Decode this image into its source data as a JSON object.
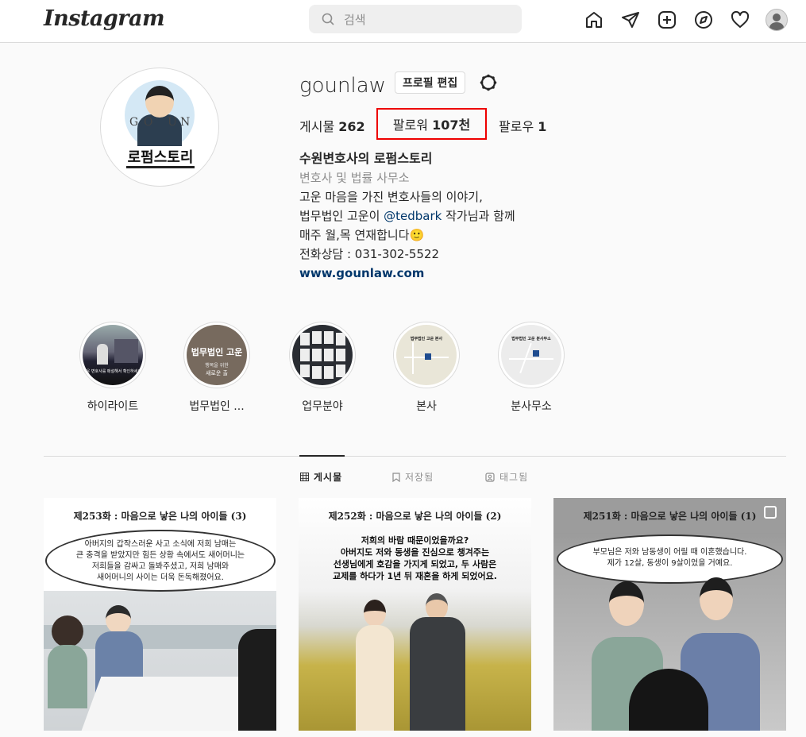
{
  "nav": {
    "logo": "Instagram",
    "search_placeholder": "검색"
  },
  "profile": {
    "username": "gounlaw",
    "edit_button": "프로필 편집",
    "pic_letters": [
      "G",
      "O",
      "U",
      "N"
    ],
    "pic_title": "로펌스토리",
    "stats": {
      "posts_label": "게시물",
      "posts_count": "262",
      "followers_label": "팔로워",
      "followers_count": "107천",
      "following_label": "팔로우",
      "following_count": "1"
    },
    "bio": {
      "name": "수원변호사의 로펌스토리",
      "category": "변호사 및 법률 사무소",
      "line1": "고운 마음을 가진 변호사들의 이야기,",
      "line2_pre": "법무법인 고운이 ",
      "line2_mention": "@tedbark",
      "line2_post": " 작가님과 함께",
      "line3": "매주 월,목 연재합니다🙂",
      "line4": "전화상담 : 031-302-5522",
      "link": "www.gounlaw.com"
    }
  },
  "highlights": [
    {
      "label": "하이라이트",
      "caption": "고운 변호사를 매설해서 확인하세요!"
    },
    {
      "label": "법무법인 ...",
      "caption_top": "법무법인 고운",
      "caption_mid": "행복을 위한",
      "caption_bot": "새로운 출"
    },
    {
      "label": "업무분야"
    },
    {
      "label": "본사",
      "caption": "법무법인 고운 본사"
    },
    {
      "label": "분사무소",
      "caption": "법무법인 고운 분사무소"
    }
  ],
  "tabs": [
    {
      "label": "게시물",
      "icon": "grid-icon",
      "active": true
    },
    {
      "label": "저장됨",
      "icon": "bookmark-icon",
      "active": false
    },
    {
      "label": "태그됨",
      "icon": "tag-icon",
      "active": false
    }
  ],
  "posts": [
    {
      "title": "제253화 : 마음으로 낳은 나의 아이들 (3)",
      "bubble_lines": [
        "아버지의 갑작스러운 사고 소식에 저희 남매는",
        "큰 충격을 받았지만 힘든 상황 속에서도 새어머니는",
        "저희들을 감싸고 돌봐주셨고, 저희 남매와",
        "새어머니의 사이는 더욱 돈독해졌어요."
      ]
    },
    {
      "title": "제252화 : 마음으로 낳은 나의 아이들 (2)",
      "text_lines": [
        "저희의 바람 때문이었을까요?",
        "아버지도 저와 동생을 진심으로 챙겨주는",
        "선생님에게 호감을 가지게 되었고, 두 사람은",
        "교제를 하다가 1년 뒤 재혼을 하게 되었어요."
      ]
    },
    {
      "title": "제251화 : 마음으로 낳은 나의 아이들 (1)",
      "bubble_lines": [
        "부모님은 저와 남동생이 어릴 때 이혼했습니다.",
        "제가 12살, 동생이 9살이었을 거예요."
      ]
    }
  ]
}
